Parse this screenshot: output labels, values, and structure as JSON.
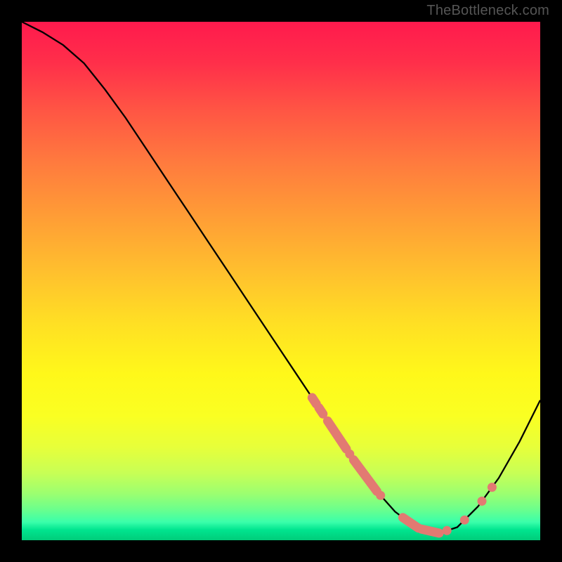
{
  "attribution": "TheBottleneck.com",
  "chart_data": {
    "type": "line",
    "title": "",
    "xlabel": "",
    "ylabel": "",
    "xlim": [
      0,
      100
    ],
    "ylim": [
      0,
      100
    ],
    "curve": {
      "x": [
        0,
        4,
        8,
        12,
        16,
        20,
        24,
        28,
        32,
        36,
        40,
        44,
        48,
        52,
        56,
        60,
        64,
        68,
        72,
        76,
        80,
        84,
        88,
        92,
        96,
        100
      ],
      "y": [
        100,
        98,
        95.5,
        92,
        87,
        81.5,
        75.5,
        69.5,
        63.5,
        57.5,
        51.5,
        45.5,
        39.5,
        33.5,
        27.5,
        21.5,
        15.5,
        10,
        5.5,
        2.5,
        1.2,
        2.5,
        6.5,
        12,
        19,
        27
      ]
    },
    "marker_clusters": [
      {
        "x_start": 56.0,
        "x_end": 56.8,
        "on_curve": true
      },
      {
        "x_start": 57.3,
        "x_end": 58.1,
        "on_curve": true
      },
      {
        "x_start": 59.0,
        "x_end": 62.6,
        "on_curve": true
      },
      {
        "x_start": 63.0,
        "x_end": 63.5,
        "on_curve": true
      },
      {
        "x_start": 64.0,
        "x_end": 68.5,
        "on_curve": true
      },
      {
        "x_start": 69.0,
        "x_end": 69.4,
        "on_curve": true
      },
      {
        "x_start": 73.5,
        "x_end": 76.5,
        "on_curve": true
      },
      {
        "x_start": 77.1,
        "x_end": 80.5,
        "on_curve": true
      },
      {
        "x_start": 81.5,
        "x_end": 82.5,
        "on_curve": true
      },
      {
        "x_start": 85.2,
        "x_end": 85.6,
        "on_curve": true
      },
      {
        "x_start": 88.5,
        "x_end": 89.0,
        "on_curve": true
      },
      {
        "x_start": 90.5,
        "x_end": 90.9,
        "on_curve": true
      }
    ],
    "background_gradient": {
      "top_color": "#ff1a4d",
      "mid_color": "#fff81a",
      "bottom_color": "#00cc7a"
    }
  }
}
